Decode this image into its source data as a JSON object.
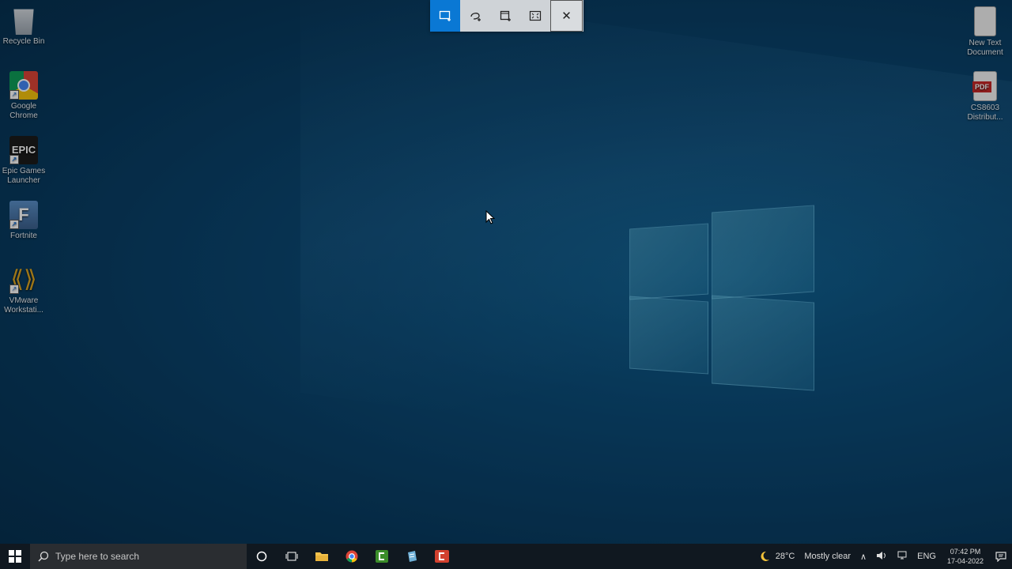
{
  "desktop": {
    "icons_left": [
      {
        "label": "Recycle Bin",
        "icon": "recycle-bin-icon"
      },
      {
        "label": "Google Chrome",
        "icon": "chrome-icon"
      },
      {
        "label": "Epic Games Launcher",
        "icon": "epic-games-icon",
        "glyph": "EPIC"
      },
      {
        "label": "Fortnite",
        "icon": "fortnite-icon",
        "glyph": "F"
      },
      {
        "label": "VMware Workstati...",
        "icon": "vmware-icon"
      }
    ],
    "icons_right": [
      {
        "label": "New Text Document",
        "icon": "text-document-icon"
      },
      {
        "label": "CS8603 Distribut...",
        "icon": "pdf-file-icon",
        "badge": "PDF"
      }
    ]
  },
  "snip_toolbar": {
    "modes": [
      "rectangular-snip",
      "freeform-snip",
      "window-snip",
      "fullscreen-snip"
    ],
    "active_mode": "rectangular-snip",
    "close_glyph": "✕"
  },
  "taskbar": {
    "search_placeholder": "Type here to search",
    "pinned": [
      "cortana-icon",
      "task-view-icon",
      "file-explorer-icon",
      "chrome-icon",
      "camtasia-icon",
      "notepad-icon",
      "screen-recorder-icon"
    ],
    "weather": {
      "temp": "28°C",
      "condition": "Mostly clear"
    },
    "language": "ENG",
    "time": "07:42 PM",
    "date": "17-04-2022"
  },
  "colors": {
    "accent": "#0a78d4",
    "taskbar_bg": "#101820"
  }
}
